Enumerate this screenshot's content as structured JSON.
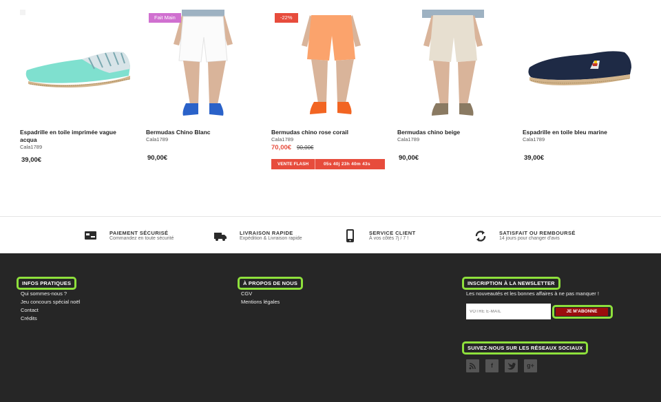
{
  "products": [
    {
      "name_line1": "Espadrille en toile imprimée vague",
      "name_line2": "acqua",
      "brand": "Cala1789",
      "price": "39,00€"
    },
    {
      "name": "Bermudas Chino Blanc",
      "brand": "Cala1789",
      "price": "90,00€",
      "badge": "Fait Main"
    },
    {
      "name": "Bermudas chino rose corail",
      "brand": "Cala1789",
      "sale_price": "70,00€",
      "old_price": "90,00€",
      "badge": "-22%",
      "flash_label": "VENTE FLASH",
      "flash_time": "05s  40j  23h  40m  43s"
    },
    {
      "name": "Bermudas chino beige",
      "brand": "Cala1789",
      "price": "90,00€"
    },
    {
      "name": "Espadrille en toile bleu marine",
      "brand": "Cala1789",
      "price": "39,00€"
    }
  ],
  "reassurance": [
    {
      "title": "PAIEMENT SÉCURISÉ",
      "subtitle": "Commandez en toute sécurité",
      "icon": "card-icon"
    },
    {
      "title": "LIVRAISON RAPIDE",
      "subtitle": "Expédition & Livraison rapide",
      "icon": "truck-icon"
    },
    {
      "title": "SERVICE CLIENT",
      "subtitle": "À vos côtés 7j / 7 !",
      "icon": "phone-icon"
    },
    {
      "title": "SATISFAIT OU REMBOURSÉ",
      "subtitle": "14 jours pour changer d'avis",
      "icon": "refresh-icon"
    }
  ],
  "footer": {
    "infos_title": "INFOS PRATIQUES",
    "infos_links": [
      "Qui sommes-nous ?",
      "Jeu concours spécial noël",
      "Contact",
      "Crédits"
    ],
    "about_title": "À PROPOS DE NOUS",
    "about_links": [
      "CGV",
      "Mentions légales"
    ],
    "newsletter_title": "INSCRIPTION À LA NEWSLETTER",
    "newsletter_text": "Les nouveautés et les bonnes affaires à ne pas manquer !",
    "newsletter_placeholder": "VOTRE E-MAIL",
    "newsletter_button": "JE M'ABONNE",
    "social_title": "SUIVEZ-NOUS SUR LES RÉSEAUX SOCIAUX",
    "social_icons": [
      "rss-icon",
      "facebook-icon",
      "twitter-icon",
      "google-plus-icon"
    ]
  },
  "colors": {
    "highlight": "#8ee03c",
    "sale": "#e74c3c",
    "footer_bg": "#262626",
    "subscribe": "#9b0d0d"
  }
}
